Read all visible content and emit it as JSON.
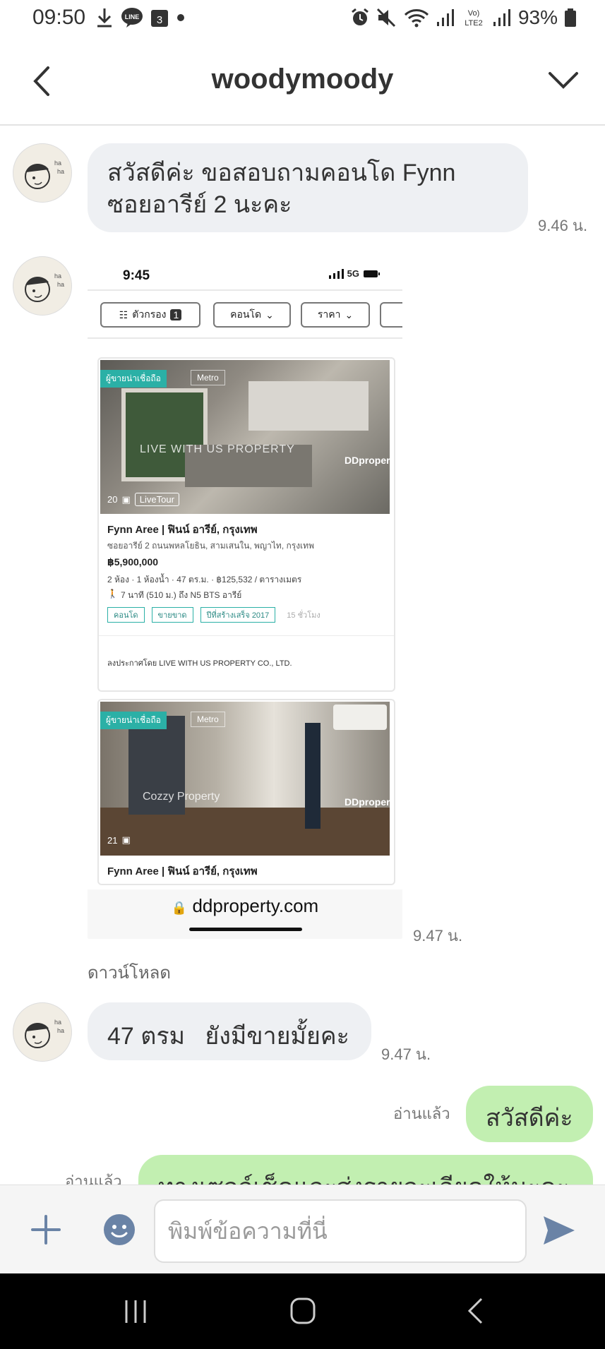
{
  "status_bar": {
    "time": "09:50",
    "battery": "93%",
    "lte_label_top": "Vo)",
    "lte_label_bottom": "LTE2",
    "line_label": "LINE",
    "calendar_day": "3"
  },
  "header": {
    "title": "woodymoody"
  },
  "messages": {
    "m1": {
      "line1": "สวัสดีค่ะ ขอสอบถามคอนโด Fynn",
      "line2": "ซอยอารีย์ 2 นะคะ",
      "time": "9.46 น."
    },
    "m2": {
      "time": "9.47 น.",
      "download": "ดาวน์โหลด"
    },
    "m3": {
      "text": "47 ตรม   ยังมีขายมั้ยคะ",
      "time": "9.47 น."
    },
    "m4": {
      "text": "สวัสดีค่ะ",
      "read": "อ่านแล้ว"
    },
    "m5": {
      "text": "ทางเซลล์เช็คและส่งรายละเอียดให้นะคะ",
      "read": "อ่านแล้ว"
    }
  },
  "screenshot": {
    "time": "9:45",
    "signal": "5G",
    "chips": [
      "ตัวกรอง",
      "คอนโด",
      "ราคา"
    ],
    "filter_count": "1",
    "listing1": {
      "badge": "ผู้ขายน่าเชื่อถือ",
      "badge2": "Metro",
      "watermark": "LIVE WITH US PROPERTY",
      "brand": "DDproperty",
      "photo_count": "20",
      "live_tour": "LiveTour",
      "title": "Fynn Aree | ฟินน์ อารีย์, กรุงเทพ",
      "address": "ซอยอารีย์ 2 ถนนพหลโยธิน, สามเสนใน, พญาไท, กรุงเทพ",
      "price": "฿5,900,000",
      "specs": "2 ห้อง · 1 ห้องน้ำ · 47 ตร.ม. · ฿125,532 / ตารางเมตร",
      "transit": "7 นาที (510 ม.) ถึง N5 BTS อารีย์",
      "tags": [
        "คอนโด",
        "ขายขาด",
        "ปีที่สร้างเสร็จ 2017"
      ],
      "posted": "15 ชั่วโมง",
      "agent": "ลงประกาศโดย LIVE WITH US PROPERTY CO., LTD."
    },
    "listing2": {
      "badge": "ผู้ขายน่าเชื่อถือ",
      "badge2": "Metro",
      "watermark": "Cozzy Property",
      "brand": "DDproperty",
      "photo_count": "21",
      "title": "Fynn Aree | ฟินน์ อารีย์, กรุงเทพ"
    },
    "url": "ddproperty.com"
  },
  "input": {
    "placeholder": "พิมพ์ข้อความที่นี่"
  },
  "colors": {
    "incoming_bubble": "#eef0f3",
    "outgoing_bubble": "#c2efb1",
    "send": "#6a83a6",
    "badge": "#2bb0a6"
  }
}
